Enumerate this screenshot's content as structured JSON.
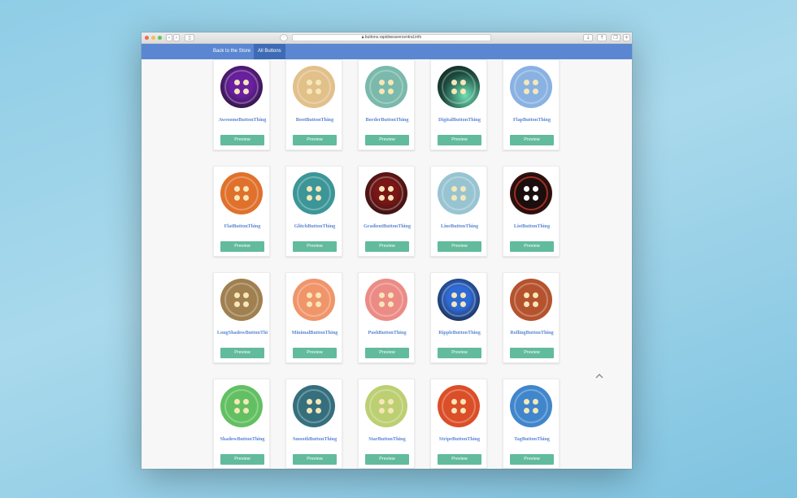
{
  "browser": {
    "url": "buttons.rapidweavercentral.info"
  },
  "nav": {
    "back_label": "Back to the Store",
    "all_label": "All Buttons"
  },
  "preview_label": "Preview",
  "cards": [
    {
      "name": "AwesomeButtonThing",
      "color": "#6a1fa0",
      "style": "radial"
    },
    {
      "name": "BootButtonThing",
      "color": "#e2c08a",
      "style": "flat"
    },
    {
      "name": "BorderButtonThing",
      "color": "#7ab9ab",
      "style": "flat"
    },
    {
      "name": "DigitalButtonThing",
      "color": "#1c4a3e",
      "style": "digital"
    },
    {
      "name": "FlapButtonThing",
      "color": "#89b2e2",
      "style": "flat"
    },
    {
      "name": "FlatButtonThing",
      "color": "#e0712c",
      "style": "flat"
    },
    {
      "name": "GlitchButtonThing",
      "color": "#3c9698",
      "style": "flat"
    },
    {
      "name": "GradientButtonThing",
      "color": "#7a1616",
      "style": "radial"
    },
    {
      "name": "LineButtonThing",
      "color": "#98c4d2",
      "style": "flat"
    },
    {
      "name": "ListButtonThing",
      "color": "#161010",
      "style": "dark"
    },
    {
      "name": "LongShadowButtonThi",
      "color": "#a08050",
      "style": "flat"
    },
    {
      "name": "MinimalButtonThing",
      "color": "#f0956a",
      "style": "flat"
    },
    {
      "name": "PushButtonThing",
      "color": "#ec8b85",
      "style": "flat"
    },
    {
      "name": "RippleButtonThing",
      "color": "#2f6bd6",
      "style": "radial"
    },
    {
      "name": "RollingButtonThing",
      "color": "#b5532e",
      "style": "flat"
    },
    {
      "name": "ShadowButtonThing",
      "color": "#62c062",
      "style": "flat"
    },
    {
      "name": "SmoothButtonThing",
      "color": "#356f7e",
      "style": "flat"
    },
    {
      "name": "StarButtonThing",
      "color": "#bccf72",
      "style": "flat"
    },
    {
      "name": "StripeButtonThing",
      "color": "#db4e28",
      "style": "flat"
    },
    {
      "name": "TagButtonThing",
      "color": "#4086cc",
      "style": "flat"
    }
  ]
}
